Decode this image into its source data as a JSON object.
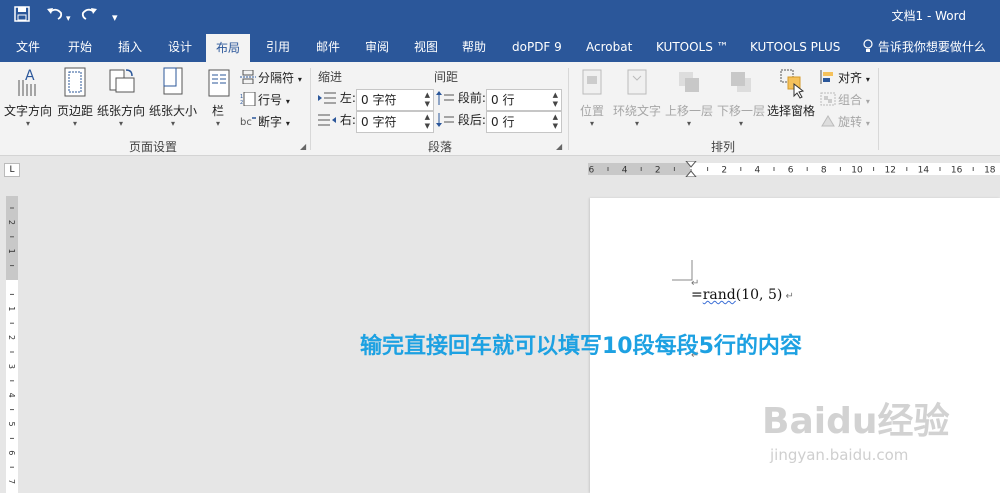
{
  "window": {
    "title": "文档1  -  Word"
  },
  "quick_access": {
    "more": "▾"
  },
  "tabs": [
    "文件",
    "开始",
    "插入",
    "设计",
    "布局",
    "引用",
    "邮件",
    "审阅",
    "视图",
    "帮助",
    "doPDF 9",
    "Acrobat",
    "KUTOOLS ™",
    "KUTOOLS PLUS"
  ],
  "tell_me": "告诉我你想要做什么",
  "ribbon": {
    "page_setup": {
      "label": "页面设置",
      "text_direction": "文字方向",
      "margins": "页边距",
      "orientation": "纸张方向",
      "size": "纸张大小",
      "columns": "栏",
      "breaks": "分隔符",
      "line_numbers": "行号",
      "hyphenation": "断字"
    },
    "paragraph": {
      "label": "段落",
      "indent_head": "缩进",
      "spacing_head": "间距",
      "left": "左:",
      "right": "右:",
      "before": "段前:",
      "after": "段后:",
      "left_value": "0 字符",
      "right_value": "0 字符",
      "before_value": "0 行",
      "after_value": "0 行"
    },
    "arrange": {
      "label": "排列",
      "position": "位置",
      "wrap_text": "环绕文字",
      "bring_forward": "上移一层",
      "send_backward": "下移一层",
      "selection_pane": "选择窗格",
      "align": "对齐",
      "group": "组合",
      "rotate": "旋转"
    }
  },
  "ruler": {
    "corner": "L",
    "h_labels": [
      "6",
      "4",
      "2",
      "2",
      "4",
      "6",
      "8",
      "10",
      "12",
      "14",
      "16",
      "18"
    ],
    "v_labels": [
      "2",
      "1",
      "1",
      "2",
      "3",
      "4",
      "5",
      "6",
      "7"
    ]
  },
  "document": {
    "formula": "=rand(10, 5)",
    "rand": "rand",
    "args": "(10, 5)",
    "pre": "="
  },
  "caption": "输完直接回车就可以填写10段每段5行的内容",
  "watermark": {
    "main": "Baidu经验",
    "sub": "jingyan.baidu.com"
  },
  "colors": {
    "title_bar": "#2b579a",
    "ribbon": "#f3f3f3",
    "caption": "#1da1e2"
  }
}
